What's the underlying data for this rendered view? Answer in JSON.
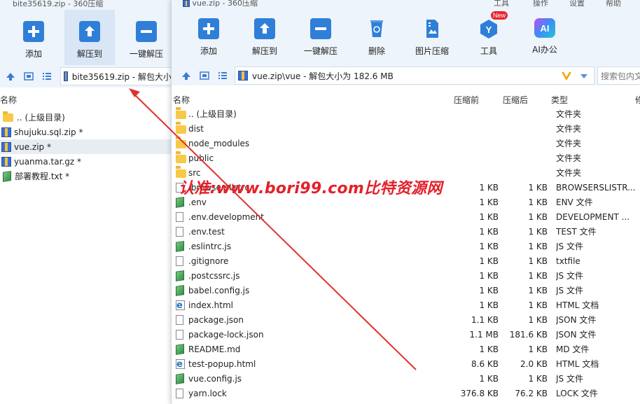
{
  "back_window": {
    "title": "bite35619.zip - 360压缩",
    "toolbar": [
      {
        "label": "添加",
        "icon": "add-icon"
      },
      {
        "label": "解压到",
        "icon": "extract-to-icon"
      },
      {
        "label": "一键解压",
        "icon": "one-click-extract-icon"
      }
    ],
    "address": "bite35619.zip - 解包大小",
    "column_name": "名称",
    "files": [
      {
        "name": ".. (上级目录)",
        "icon": "folder-icon"
      },
      {
        "name": "shujuku.sql.zip *",
        "icon": "zip-icon"
      },
      {
        "name": "vue.zip *",
        "icon": "zip-icon"
      },
      {
        "name": "yuanma.tar.gz *",
        "icon": "zip-icon"
      },
      {
        "name": "部署教程.txt *",
        "icon": "green-file-icon"
      }
    ]
  },
  "front_window": {
    "title": "vue.zip - 360压缩",
    "top_right_labels": [
      "工具",
      "操作",
      "设置",
      "帮助"
    ],
    "toolbar": [
      {
        "label": "添加",
        "icon": "add-icon"
      },
      {
        "label": "解压到",
        "icon": "extract-to-icon"
      },
      {
        "label": "一键解压",
        "icon": "one-click-extract-icon"
      },
      {
        "label": "删除",
        "icon": "delete-icon"
      },
      {
        "label": "图片压缩",
        "icon": "image-compress-icon"
      },
      {
        "label": "工具",
        "icon": "tools-icon",
        "badge": "New"
      },
      {
        "label": "AI办公",
        "icon": "ai-office-icon",
        "badge_text": "AI"
      }
    ],
    "address": "vue.zip\\vue - 解包大小为 182.6 MB",
    "search_placeholder": "搜索包内文",
    "columns": {
      "name": "名称",
      "before": "压缩前",
      "after": "压缩后",
      "type": "类型",
      "extra": "修"
    },
    "files": [
      {
        "name": ".. (上级目录)",
        "before": "",
        "after": "",
        "type": "文件夹",
        "icon": "folder"
      },
      {
        "name": "dist",
        "before": "",
        "after": "",
        "type": "文件夹",
        "icon": "folder"
      },
      {
        "name": "node_modules",
        "before": "",
        "after": "",
        "type": "文件夹",
        "icon": "folder"
      },
      {
        "name": "public",
        "before": "",
        "after": "",
        "type": "文件夹",
        "icon": "folder"
      },
      {
        "name": "src",
        "before": "",
        "after": "",
        "type": "文件夹",
        "icon": "folder"
      },
      {
        "name": ".browserslistrc",
        "before": "1 KB",
        "after": "1 KB",
        "type": "BROWSERSLISTR...",
        "icon": "file"
      },
      {
        "name": ".env",
        "before": "1 KB",
        "after": "1 KB",
        "type": "ENV 文件",
        "icon": "green"
      },
      {
        "name": ".env.development",
        "before": "1 KB",
        "after": "1 KB",
        "type": "DEVELOPMENT ...",
        "icon": "file"
      },
      {
        "name": ".env.test",
        "before": "1 KB",
        "after": "1 KB",
        "type": "TEST 文件",
        "icon": "file"
      },
      {
        "name": ".eslintrc.js",
        "before": "1 KB",
        "after": "1 KB",
        "type": "JS 文件",
        "icon": "green"
      },
      {
        "name": ".gitignore",
        "before": "1 KB",
        "after": "1 KB",
        "type": "txtfile",
        "icon": "file"
      },
      {
        "name": ".postcssrc.js",
        "before": "1 KB",
        "after": "1 KB",
        "type": "JS 文件",
        "icon": "green"
      },
      {
        "name": "babel.config.js",
        "before": "1 KB",
        "after": "1 KB",
        "type": "JS 文件",
        "icon": "green"
      },
      {
        "name": "index.html",
        "before": "1 KB",
        "after": "1 KB",
        "type": "HTML 文档",
        "icon": "html"
      },
      {
        "name": "package.json",
        "before": "1.1 KB",
        "after": "1 KB",
        "type": "JSON 文件",
        "icon": "file"
      },
      {
        "name": "package-lock.json",
        "before": "1.1 MB",
        "after": "181.6 KB",
        "type": "JSON 文件",
        "icon": "file"
      },
      {
        "name": "README.md",
        "before": "1 KB",
        "after": "1 KB",
        "type": "MD 文件",
        "icon": "green"
      },
      {
        "name": "test-popup.html",
        "before": "8.6 KB",
        "after": "2.0 KB",
        "type": "HTML 文档",
        "icon": "html"
      },
      {
        "name": "vue.config.js",
        "before": "1 KB",
        "after": "1 KB",
        "type": "JS 文件",
        "icon": "green"
      },
      {
        "name": "yarn.lock",
        "before": "376.8 KB",
        "after": "76.2 KB",
        "type": "LOCK 文件",
        "icon": "file"
      }
    ]
  },
  "watermark": "认准:www.bori99.com比特资源网",
  "colors": {
    "toolbar_bg": "#eef4fb",
    "accent_blue": "#2f7fd8",
    "watermark_red": "#e4202a",
    "arrow_red": "#e0322c"
  }
}
